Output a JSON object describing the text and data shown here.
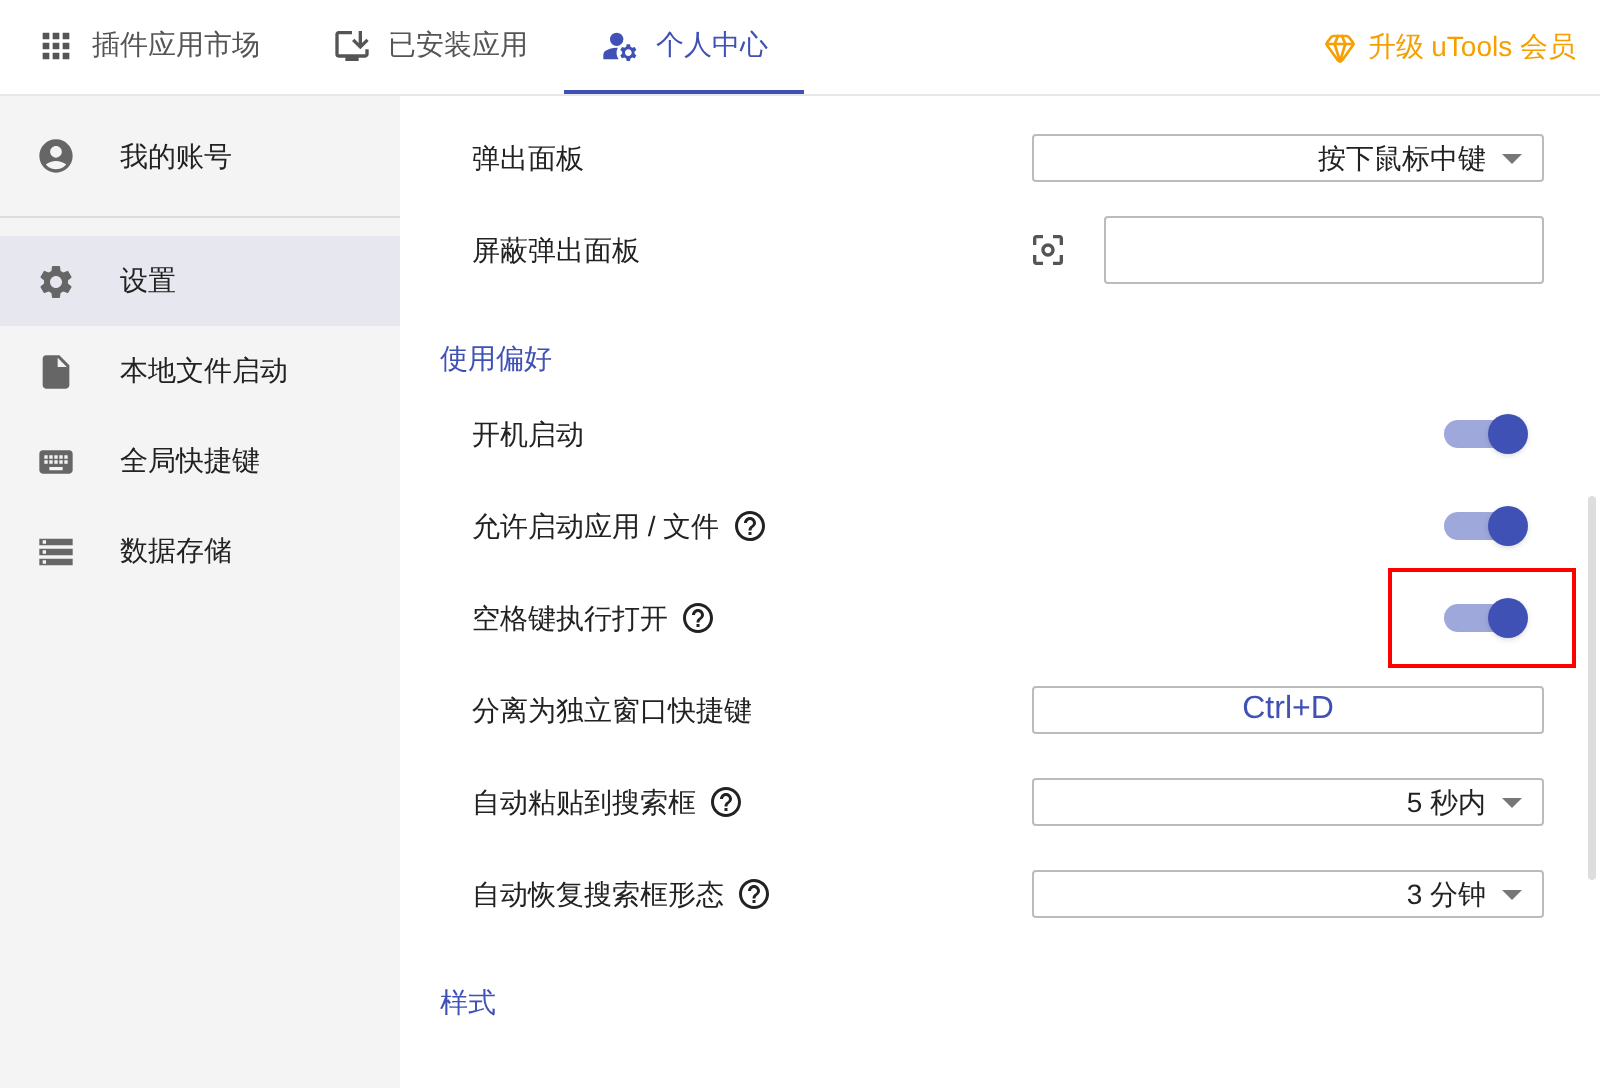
{
  "tabs": [
    {
      "label": "插件应用市场",
      "selected": false
    },
    {
      "label": "已安装应用",
      "selected": false
    },
    {
      "label": "个人中心",
      "selected": true
    }
  ],
  "upgrade": {
    "label": "升级 uTools 会员"
  },
  "sidebar": {
    "account": {
      "label": "我的账号"
    },
    "items": [
      {
        "label": "设置",
        "selected": true
      },
      {
        "label": "本地文件启动",
        "selected": false
      },
      {
        "label": "全局快捷键",
        "selected": false
      },
      {
        "label": "数据存储",
        "selected": false
      }
    ]
  },
  "settings": [
    {
      "kind": "select",
      "label": "弹出面板",
      "value": "按下鼠标中键"
    },
    {
      "kind": "capture",
      "label": "屏蔽弹出面板"
    },
    {
      "kind": "section",
      "label": "使用偏好"
    },
    {
      "kind": "toggle",
      "label": "开机启动",
      "on": true
    },
    {
      "kind": "toggle",
      "label": "允许启动应用 / 文件",
      "on": true,
      "help": true
    },
    {
      "kind": "toggle",
      "label": "空格键执行打开",
      "on": true,
      "help": true,
      "highlighted": true
    },
    {
      "kind": "hotkey",
      "label": "分离为独立窗口快捷键",
      "value": "Ctrl+D"
    },
    {
      "kind": "select",
      "label": "自动粘贴到搜索框",
      "value": "5 秒内",
      "help": true
    },
    {
      "kind": "select",
      "label": "自动恢复搜索框形态",
      "value": "3 分钟",
      "help": true
    },
    {
      "kind": "section",
      "label": "样式"
    }
  ]
}
